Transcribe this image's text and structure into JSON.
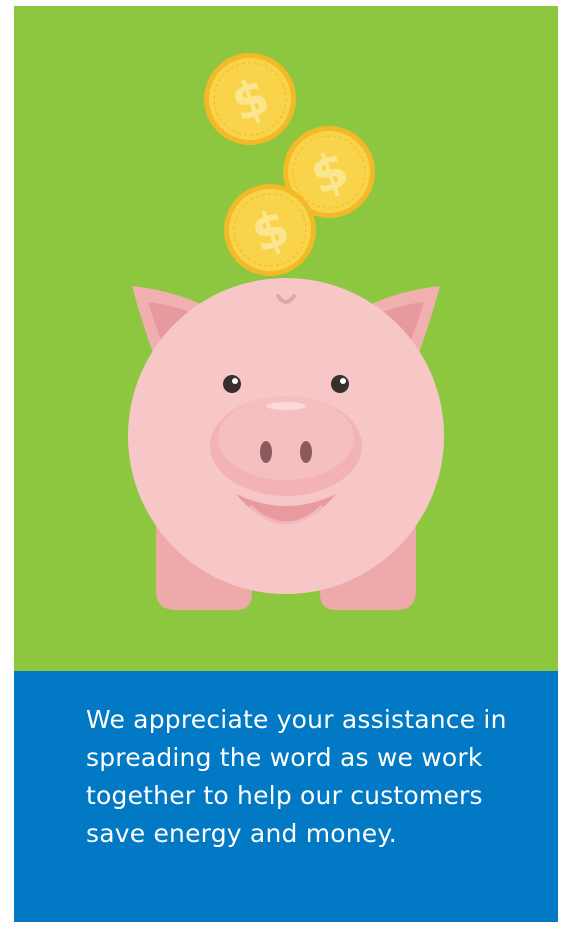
{
  "colors": {
    "background": "#8dc63f",
    "panel": "#0179c4",
    "coin": "#f7d13b",
    "pig": "#f6c3c3"
  },
  "coins": [
    {
      "symbol": "$",
      "icon": "dollar-coin-icon"
    },
    {
      "symbol": "$",
      "icon": "dollar-coin-icon"
    },
    {
      "symbol": "$",
      "icon": "dollar-coin-icon"
    }
  ],
  "message": "We appreciate your assistance in spreading the word as we work together to help our customers save energy and money."
}
